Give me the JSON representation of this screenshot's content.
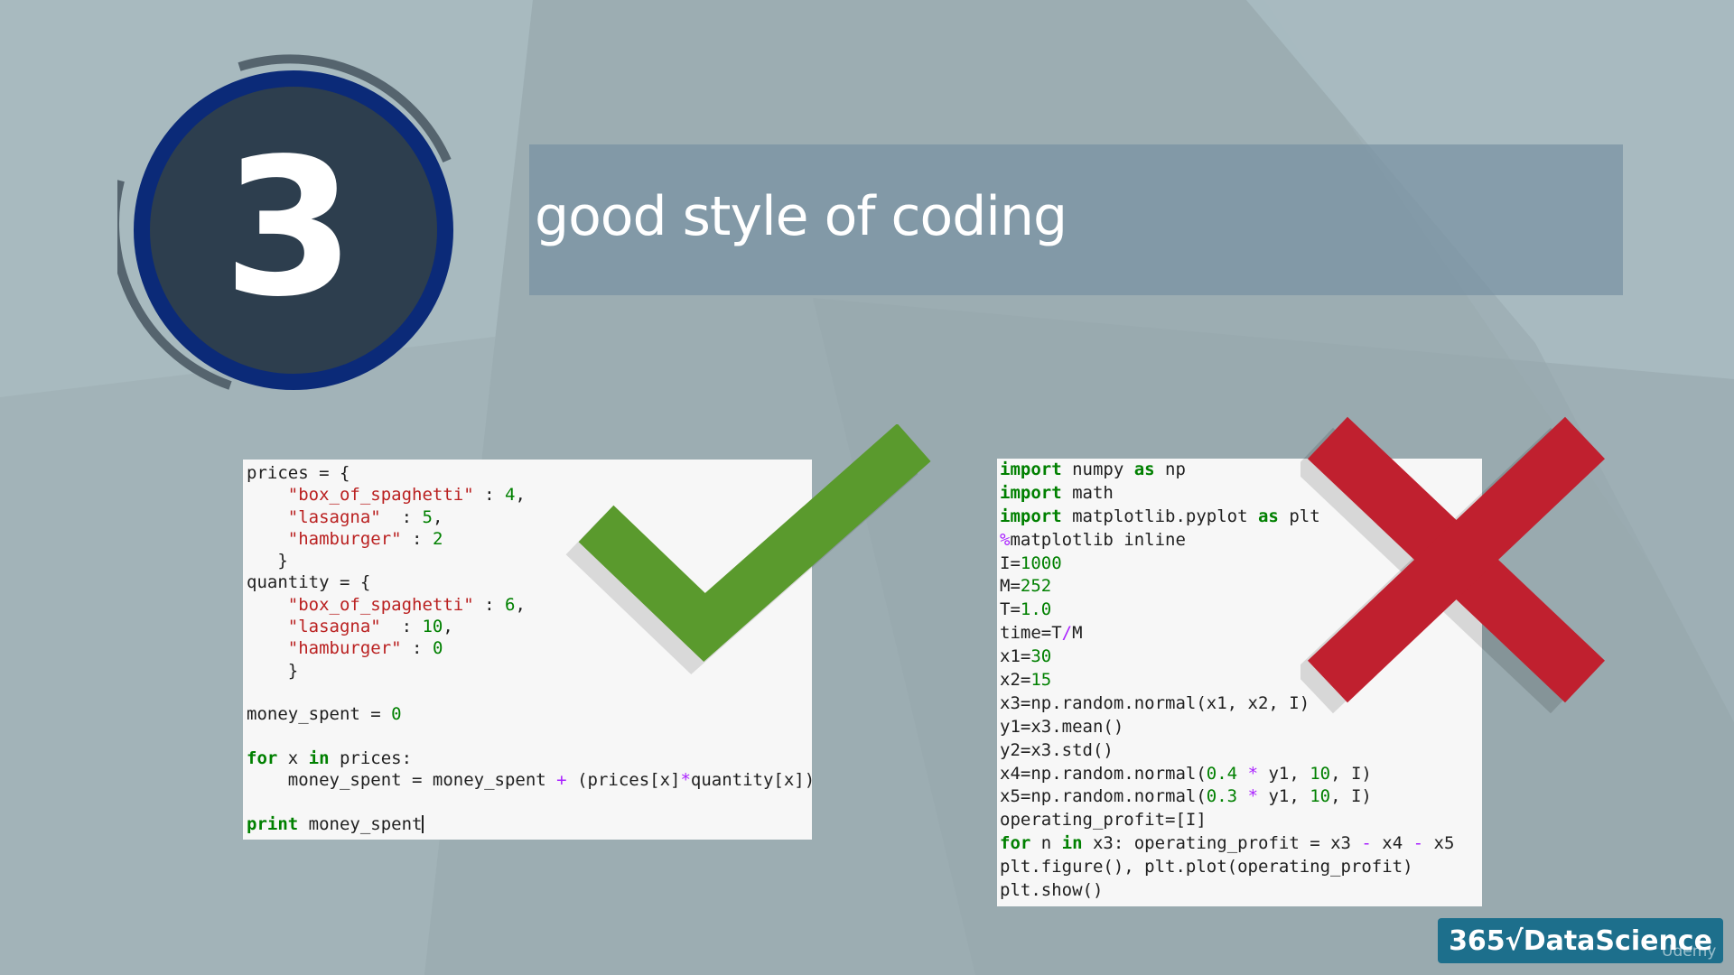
{
  "slide": {
    "number": "3",
    "title": "good style of coding"
  },
  "good_code": {
    "lines": [
      [
        [
          "prices = {",
          ""
        ]
      ],
      [
        [
          "    ",
          ""
        ],
        [
          "\"box_of_spaghetti\"",
          "st"
        ],
        [
          " : ",
          ""
        ],
        [
          "4",
          "nm"
        ],
        [
          ",",
          ""
        ]
      ],
      [
        [
          "    ",
          ""
        ],
        [
          "\"lasagna\"",
          "st"
        ],
        [
          "  : ",
          ""
        ],
        [
          "5",
          "nm"
        ],
        [
          ",",
          ""
        ]
      ],
      [
        [
          "    ",
          ""
        ],
        [
          "\"hamburger\"",
          "st"
        ],
        [
          " : ",
          ""
        ],
        [
          "2",
          "nm"
        ]
      ],
      [
        [
          "   }",
          ""
        ]
      ],
      [
        [
          "quantity = {",
          ""
        ]
      ],
      [
        [
          "    ",
          ""
        ],
        [
          "\"box_of_spaghetti\"",
          "st"
        ],
        [
          " : ",
          ""
        ],
        [
          "6",
          "nm"
        ],
        [
          ",",
          ""
        ]
      ],
      [
        [
          "    ",
          ""
        ],
        [
          "\"lasagna\"",
          "st"
        ],
        [
          "  : ",
          ""
        ],
        [
          "10",
          "nm"
        ],
        [
          ",",
          ""
        ]
      ],
      [
        [
          "    ",
          ""
        ],
        [
          "\"hamburger\"",
          "st"
        ],
        [
          " : ",
          ""
        ],
        [
          "0",
          "nm"
        ]
      ],
      [
        [
          "    }",
          ""
        ]
      ],
      [
        [
          "",
          ""
        ]
      ],
      [
        [
          "money_spent = ",
          ""
        ],
        [
          "0",
          "nm"
        ]
      ],
      [
        [
          "",
          ""
        ]
      ],
      [
        [
          "for",
          "kw"
        ],
        [
          " x ",
          ""
        ],
        [
          "in",
          "kw"
        ],
        [
          " prices:",
          ""
        ]
      ],
      [
        [
          "    money_spent = money_spent ",
          ""
        ],
        [
          "+",
          "op"
        ],
        [
          " (prices[x]",
          ""
        ],
        [
          "*",
          "op"
        ],
        [
          "quantity[x])",
          ""
        ]
      ],
      [
        [
          "",
          ""
        ]
      ],
      [
        [
          "print",
          "kw"
        ],
        [
          " money_spent",
          ""
        ]
      ]
    ]
  },
  "bad_code": {
    "lines": [
      [
        [
          "import",
          "kw"
        ],
        [
          " numpy ",
          ""
        ],
        [
          "as",
          "kw"
        ],
        [
          " np",
          ""
        ]
      ],
      [
        [
          "import",
          "kw"
        ],
        [
          " math",
          ""
        ]
      ],
      [
        [
          "import",
          "kw"
        ],
        [
          " matplotlib.pyplot ",
          ""
        ],
        [
          "as",
          "kw"
        ],
        [
          " plt",
          ""
        ]
      ],
      [
        [
          "%",
          "op"
        ],
        [
          "matplotlib inline",
          ""
        ]
      ],
      [
        [
          "I=",
          ""
        ],
        [
          "1000",
          "nm"
        ]
      ],
      [
        [
          "M=",
          ""
        ],
        [
          "252",
          "nm"
        ]
      ],
      [
        [
          "T=",
          ""
        ],
        [
          "1.0",
          "nm"
        ]
      ],
      [
        [
          "time=T",
          ""
        ],
        [
          "/",
          "op"
        ],
        [
          "M",
          ""
        ]
      ],
      [
        [
          "x1=",
          ""
        ],
        [
          "30",
          "nm"
        ]
      ],
      [
        [
          "x2=",
          ""
        ],
        [
          "15",
          "nm"
        ]
      ],
      [
        [
          "x3=np.random.normal(x1, x2, I)",
          ""
        ]
      ],
      [
        [
          "y1=x3.mean()",
          ""
        ]
      ],
      [
        [
          "y2=x3.std()",
          ""
        ]
      ],
      [
        [
          "x4=np.random.normal(",
          ""
        ],
        [
          "0.4",
          "nm"
        ],
        [
          " ",
          ""
        ],
        [
          "*",
          "op"
        ],
        [
          " y1, ",
          ""
        ],
        [
          "10",
          "nm"
        ],
        [
          ", I)",
          ""
        ]
      ],
      [
        [
          "x5=np.random.normal(",
          ""
        ],
        [
          "0.3",
          "nm"
        ],
        [
          " ",
          ""
        ],
        [
          "*",
          "op"
        ],
        [
          " y1, ",
          ""
        ],
        [
          "10",
          "nm"
        ],
        [
          ", I)",
          ""
        ]
      ],
      [
        [
          "operating_profit=[I]",
          ""
        ]
      ],
      [
        [
          "for",
          "kw"
        ],
        [
          " n ",
          ""
        ],
        [
          "in",
          "kw"
        ],
        [
          " x3: operating_profit = x3 ",
          ""
        ],
        [
          "-",
          "op"
        ],
        [
          " x4 ",
          ""
        ],
        [
          "-",
          "op"
        ],
        [
          " x5",
          ""
        ]
      ],
      [
        [
          "plt.figure(), plt.plot(operating_profit)",
          ""
        ]
      ],
      [
        [
          "plt.show()",
          ""
        ]
      ]
    ]
  },
  "branding": {
    "logo_text": "365√DataScience",
    "watermark": "Udemy"
  },
  "colors": {
    "check": "#5a9a2d",
    "cross": "#c0202f",
    "circle_fill": "#2d3e4e",
    "circle_ring": "#0b2a78"
  },
  "icons": {
    "good": "checkmark-icon",
    "bad": "cross-icon"
  }
}
